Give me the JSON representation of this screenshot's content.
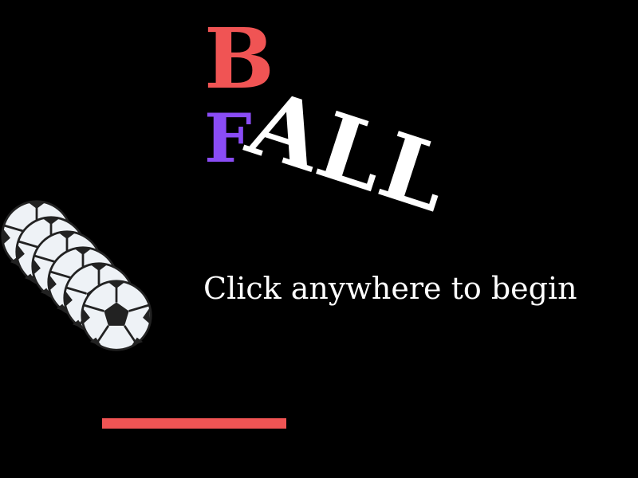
{
  "title": {
    "letter_b": "B",
    "letter_f": "F",
    "word_all": "ALL"
  },
  "prompt": {
    "text": "Click anywhere to begin"
  },
  "colors": {
    "background": "#000000",
    "letter_b": "#f05454",
    "letter_f": "#8a4cf5",
    "word_all": "#ffffff",
    "prompt": "#ffffff",
    "paddle": "#f05454"
  },
  "sprites": {
    "ball_icon": "soccer-ball-icon",
    "ball_trail_count": 6,
    "paddle": "paddle"
  }
}
